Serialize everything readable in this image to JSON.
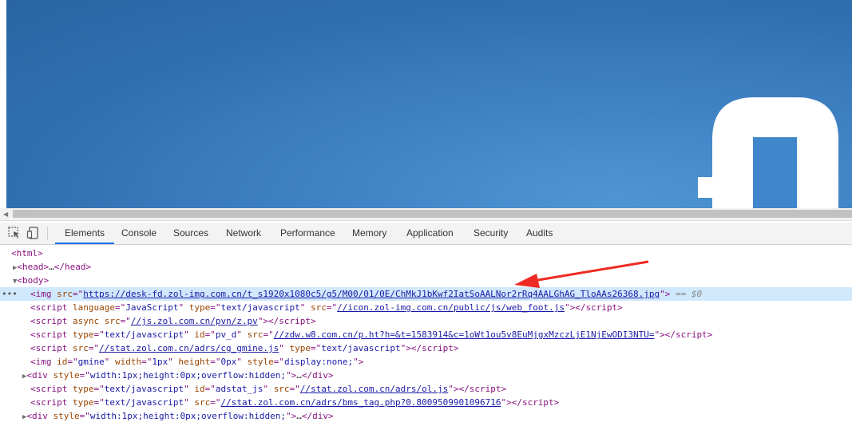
{
  "page": {
    "background_color": "#2f6fb0"
  },
  "toolbar": {
    "inspect_icon": "cursor-select-icon",
    "device_icon": "device-toggle-icon",
    "tabs": [
      "Elements",
      "Console",
      "Sources",
      "Network",
      "Performance",
      "Memory",
      "Application",
      "Security",
      "Audits"
    ],
    "active_tab": "Elements"
  },
  "dom": {
    "html_open": "<html>",
    "head": {
      "open": "<head>",
      "ellipsis": "…",
      "close": "</head>"
    },
    "body_open": "<body>",
    "img1": {
      "tag": "<img",
      "attr": "src",
      "value": "https://desk-fd.zol-img.com.cn/t_s1920x1080c5/g5/M00/01/0E/ChMkJ1bKwf2IatSoAALNor2rRq4AALGhAG_TloAAs26368.jpg",
      "close": ">",
      "sel_hint": "== $0"
    },
    "script1": {
      "lang_value": "JavaScript",
      "type_value": "text/javascript",
      "src_value": "//icon.zol-img.com.cn/public/js/web_foot.js"
    },
    "script2": {
      "src_value": "//js.zol.com.cn/pvn/z.pv"
    },
    "script3": {
      "type_value": "text/javascript",
      "id_value": "pv_d",
      "src_value": "//zdw.w8.com.cn/p.ht?h=&t=1583914&c=1oWt1ou5v8EuMjgxMzczLjE1NjEwODI3NTU="
    },
    "script4": {
      "src_value": "//stat.zol.com.cn/adrs/cg_gmine.js",
      "type_value": "text/javascript"
    },
    "img2": {
      "id_value": "gmine",
      "width_value": "1px",
      "height_value": "0px",
      "style_value": "display:none;"
    },
    "div1": {
      "style_value": "width:1px;height:0px;overflow:hidden;",
      "ellipsis": "…"
    },
    "script5": {
      "type_value": "text/javascript",
      "id_value": "adstat_js",
      "src_value": "//stat.zol.com.cn/adrs/ol.js"
    },
    "script6": {
      "type_value": "text/javascript",
      "src_value": "//stat.zol.com.cn/adrs/bms_tag.php?0.8009509901096716"
    },
    "div2": {
      "style_value": "width:1px;height:0px;overflow:hidden;",
      "ellipsis": "…"
    }
  },
  "annotation": {
    "arrow_color": "#ee2a24"
  }
}
